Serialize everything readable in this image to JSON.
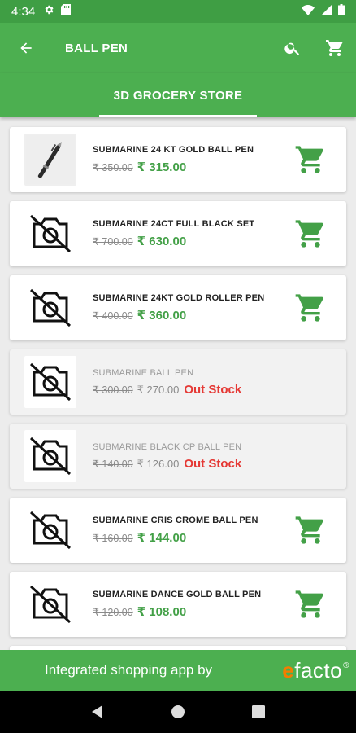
{
  "status_bar": {
    "time": "4:34",
    "icons_left": [
      "gear-icon",
      "sd-card-icon"
    ],
    "icons_right": [
      "wifi-icon",
      "signal-icon",
      "battery-icon"
    ]
  },
  "app_bar": {
    "title": "BALL PEN",
    "back_icon": "arrow-left-icon",
    "actions": [
      "search-icon",
      "cart-icon"
    ]
  },
  "tabs": [
    {
      "label": "3D GROCERY STORE",
      "selected": true
    }
  ],
  "colors": {
    "primary": "#4caf50",
    "price_green": "#43a047",
    "out_of_stock_red": "#e53935",
    "logo_orange": "#f57c00"
  },
  "products": [
    {
      "name": "SUBMARINE 24 KT GOLD BALL PEN",
      "mrp": "₹ 350.00",
      "price": "₹ 315.00",
      "image": "pen-photo",
      "in_stock": true,
      "stock_label": ""
    },
    {
      "name": "SUBMARINE 24CT FULL BLACK SET",
      "mrp": "₹ 700.00",
      "price": "₹ 630.00",
      "image": "no-image-icon",
      "in_stock": true,
      "stock_label": ""
    },
    {
      "name": "SUBMARINE 24KT GOLD ROLLER PEN",
      "mrp": "₹ 400.00",
      "price": "₹ 360.00",
      "image": "no-image-icon",
      "in_stock": true,
      "stock_label": ""
    },
    {
      "name": "SUBMARINE BALL PEN",
      "mrp": "₹ 300.00",
      "price": "₹ 270.00",
      "image": "no-image-icon",
      "in_stock": false,
      "stock_label": "Out Stock"
    },
    {
      "name": "SUBMARINE BLACK CP BALL PEN",
      "mrp": "₹ 140.00",
      "price": "₹ 126.00",
      "image": "no-image-icon",
      "in_stock": false,
      "stock_label": "Out Stock"
    },
    {
      "name": "SUBMARINE CRIS CROME BALL PEN",
      "mrp": "₹ 160.00",
      "price": "₹ 144.00",
      "image": "no-image-icon",
      "in_stock": true,
      "stock_label": ""
    },
    {
      "name": "SUBMARINE DANCE GOLD BALL PEN",
      "mrp": "₹ 120.00",
      "price": "₹ 108.00",
      "image": "no-image-icon",
      "in_stock": true,
      "stock_label": ""
    }
  ],
  "footer": {
    "promo_text": "Integrated shopping app by",
    "logo_e": "e",
    "logo_rest": "facto",
    "logo_mark": "®"
  },
  "nav_bar": [
    "back-triangle-icon",
    "home-circle-icon",
    "recents-square-icon"
  ]
}
